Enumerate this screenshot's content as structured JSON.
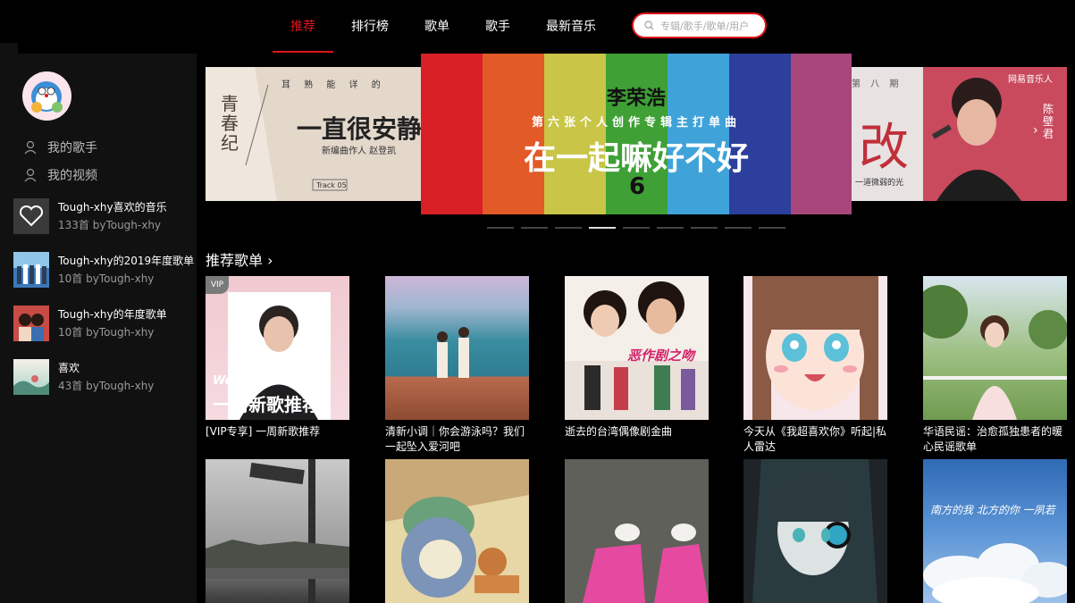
{
  "nav": {
    "tabs": [
      {
        "label": "推荐",
        "active": true
      },
      {
        "label": "排行榜",
        "active": false
      },
      {
        "label": "歌单",
        "active": false
      },
      {
        "label": "歌手",
        "active": false
      },
      {
        "label": "最新音乐",
        "active": false
      }
    ],
    "search_placeholder": "专辑/歌手/歌单/用户",
    "accent": "#e0141c"
  },
  "sidebar": {
    "links": [
      {
        "label": "我的歌手",
        "icon": "user-icon"
      },
      {
        "label": "我的视频",
        "icon": "user-icon"
      }
    ],
    "playlists": [
      {
        "name": "Tough-xhy喜欢的音乐",
        "meta": "133首 byTough-xhy"
      },
      {
        "name": "Tough-xhy的2019年度歌单",
        "meta": "10首 byTough-xhy"
      },
      {
        "name": "Tough-xhy的年度歌单",
        "meta": "10首 byTough-xhy"
      },
      {
        "name": "喜欢",
        "meta": "43首 byTough-xhy"
      }
    ]
  },
  "banner": {
    "left": {
      "kicker": "耳 熟 能 详 的",
      "headline": "一直很安静",
      "credit": "新编曲作人 赵登凯",
      "track": "Track 05",
      "vertical_title": "青春纪"
    },
    "center": {
      "artist": "李荣浩",
      "subtitle": "第六张个人创作专辑主打单曲",
      "headline": "在一起嘛好不好",
      "number": "6"
    },
    "right": {
      "brand": "网易音乐人",
      "kicker": "第 八 期",
      "glyph": "改",
      "caption": "一道微弱的光",
      "vertical": "陈壁君"
    },
    "page_count": 9,
    "active_page": 4
  },
  "recommend": {
    "title": "推荐歌单",
    "cards": [
      {
        "caption": "[VIP专享] 一周新歌推荐",
        "badge": "VIP",
        "overlay_small": "Weekly",
        "overlay_big": "一周新歌推荐"
      },
      {
        "caption": "清新小调｜你会游泳吗？我们一起坠入爱河吧"
      },
      {
        "caption": "逝去的台湾偶像剧金曲",
        "overlay_text": "恶作剧之吻"
      },
      {
        "caption": "今天从《我超喜欢你》听起|私人雷达"
      },
      {
        "caption": "华语民谣：治愈孤独患者的暖心民谣歌单"
      },
      {
        "caption": ""
      },
      {
        "caption": ""
      },
      {
        "caption": ""
      },
      {
        "caption": ""
      },
      {
        "caption": "",
        "overlay_text": "南方的我 北方的你 一夙若"
      }
    ]
  }
}
